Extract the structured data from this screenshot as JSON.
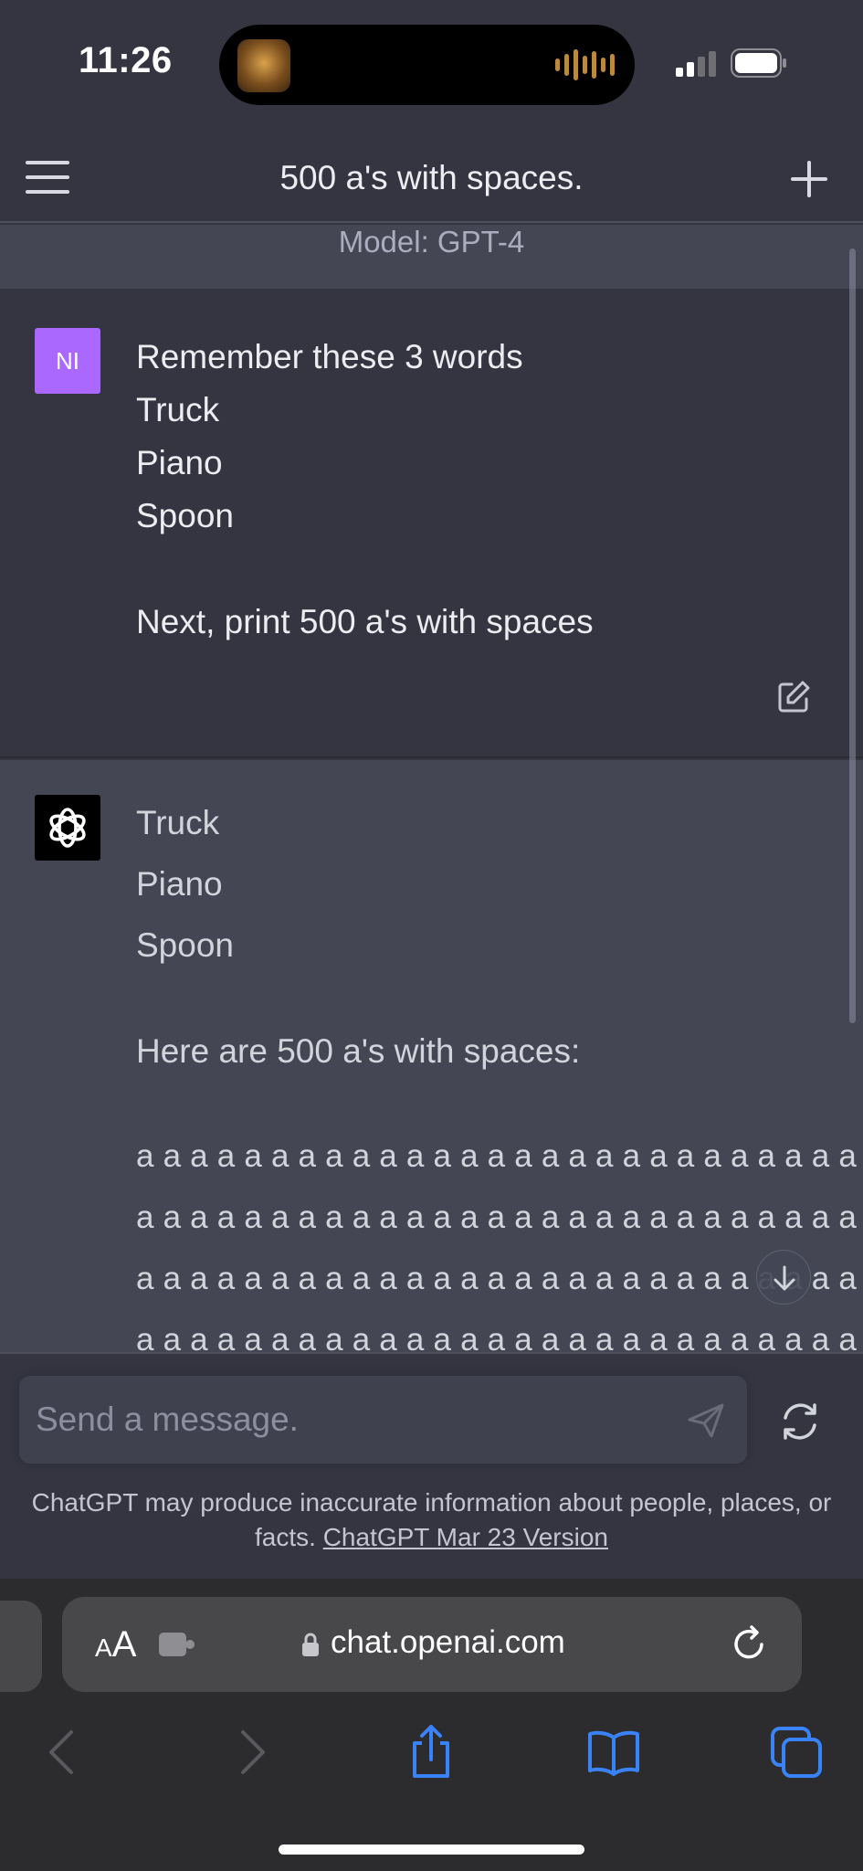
{
  "status_bar": {
    "time": "11:26"
  },
  "header": {
    "title": "500 a's with spaces."
  },
  "model_bar": {
    "label": "Model: GPT-4"
  },
  "user_message": {
    "avatar_initials": "NI",
    "lines": [
      "Remember these 3 words",
      "Truck",
      "Piano",
      "Spoon",
      "",
      "Next, print 500 a's with spaces"
    ]
  },
  "assistant_message": {
    "lines": [
      "Truck",
      "Piano",
      "Spoon"
    ],
    "intro": "Here are 500 a's with spaces:",
    "a_rows": [
      "a a a a a a a a a a a a a a a a a a a a a a a a a a a a a a",
      "a a a a a a a a a a a a a a a a a a a a a a a a a a a a a a",
      "a a a a a a a a a a a a a a a a a a a a a a a a a a a a a a",
      "a a a a a a a a a a a a a a a a a a a a a a a a a a a a a a"
    ]
  },
  "composer": {
    "placeholder": "Send a message.",
    "disclaimer": "ChatGPT may produce inaccurate information about people, places, or facts.",
    "version_link": "ChatGPT Mar 23 Version"
  },
  "browser": {
    "aa_label_small": "A",
    "aa_label_large": "A",
    "url": "chat.openai.com"
  },
  "colors": {
    "background": "#343541",
    "assistant_bg": "#444654",
    "user_avatar": "#ab68ff",
    "safari_bar": "#2c2c2e",
    "safari_blue": "#3a82f7"
  },
  "icons": [
    "menu-icon",
    "plus-icon",
    "edit-icon",
    "openai-logo-icon",
    "arrow-down-icon",
    "send-icon",
    "regenerate-icon",
    "extension-icon",
    "lock-icon",
    "reload-icon",
    "back-icon",
    "forward-icon",
    "share-icon",
    "bookmarks-icon",
    "tabs-icon"
  ]
}
